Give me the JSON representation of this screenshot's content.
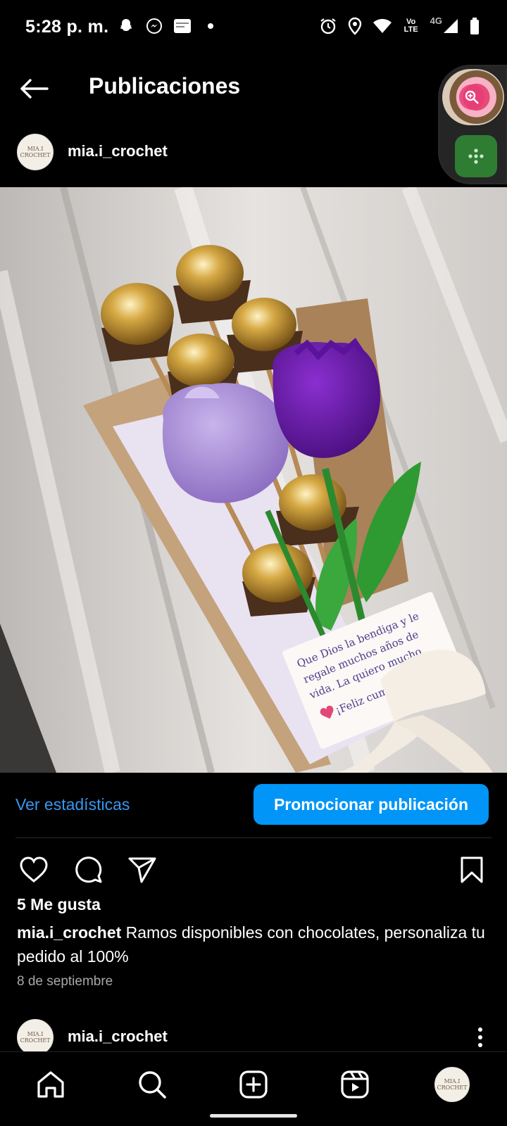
{
  "status_bar": {
    "time": "5:28 p. m.",
    "left_icons": [
      "snapchat-icon",
      "messenger-icon",
      "card-notification-icon",
      "dot-icon"
    ],
    "right_icons": [
      "alarm-icon",
      "location-icon",
      "wifi-icon",
      "volte-icon",
      "signal-icon",
      "battery-icon"
    ],
    "volte_label": "Vo LTE",
    "network_label": "4G"
  },
  "header": {
    "title": "Publicaciones"
  },
  "post": {
    "author": "mia.i_crochet",
    "avatar_text": "MIA.I CROCHET",
    "image_card": {
      "lines": [
        "Que Dios la bendiga y le",
        "regale muchos años de",
        "vida. La quiero mucho",
        "¡Feliz cumpleaños!"
      ]
    },
    "stats_link": "Ver estadísticas",
    "promote_button": "Promocionar publicación",
    "likes": "5 Me gusta",
    "caption_user": "mia.i_crochet",
    "caption_text": " Ramos disponibles con chocolates, personaliza tu pedido al 100%",
    "date": "8 de septiembre"
  },
  "next_post": {
    "author": "mia.i_crochet",
    "avatar_text": "MIA.I CROCHET"
  },
  "colors": {
    "accent": "#0095f6",
    "link": "#3897f0",
    "background": "#000000"
  }
}
